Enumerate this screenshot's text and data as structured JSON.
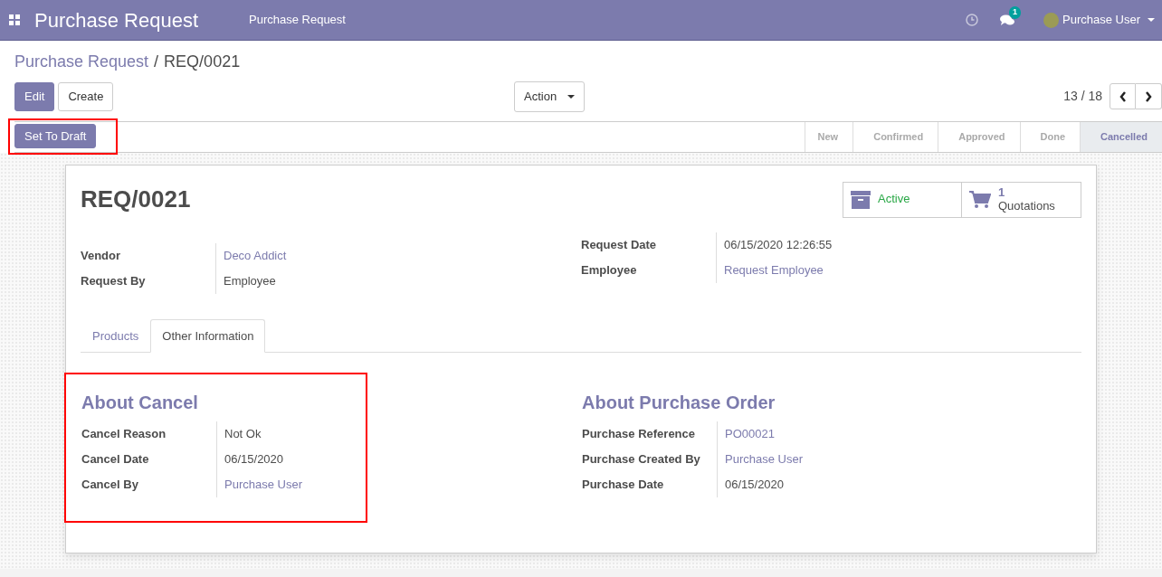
{
  "navbar": {
    "app_title": "Purchase Request",
    "menu": [
      "Purchase Request"
    ],
    "messages_count": "1",
    "user": "Purchase User"
  },
  "breadcrumb": {
    "parent": "Purchase Request",
    "separator": "/",
    "current": "REQ/0021"
  },
  "buttons": [
    "Edit",
    "Create"
  ],
  "action": "Action",
  "pager": "13 / 18",
  "status_bar": {
    "highlighted": true,
    "actions": [
      "Set To Draft"
    ],
    "stages": [
      {
        "label": "New",
        "selected": false
      },
      {
        "label": "Confirmed",
        "selected": false
      },
      {
        "label": "Approved",
        "selected": false
      },
      {
        "label": "Done",
        "selected": false
      },
      {
        "label": "Cancelled",
        "selected": true
      }
    ]
  },
  "sheet": {
    "title": "REQ/0021",
    "smart_buttons": [
      {
        "kind": "archive",
        "label": "Active"
      },
      {
        "kind": "cart",
        "count": "1",
        "label": "Quotations"
      }
    ],
    "left_fields": [
      {
        "label": "Vendor",
        "value": "Deco Addict",
        "kind": "link"
      },
      {
        "label": "Request By",
        "value": "Employee",
        "kind": "text"
      }
    ],
    "right_fields": [
      {
        "label": "Request Date",
        "value": "06/15/2020 12:26:55",
        "kind": "text"
      },
      {
        "label": "Employee",
        "value": "Request Employee",
        "kind": "link"
      }
    ],
    "tabs": [
      {
        "label": "Products",
        "selected": false
      },
      {
        "label": "Other Information",
        "selected": true
      }
    ],
    "sections": [
      {
        "title": "About Cancel",
        "highlighted": true,
        "fields": [
          {
            "label": "Cancel Reason",
            "value": "Not Ok",
            "kind": "text"
          },
          {
            "label": "Cancel Date",
            "value": "06/15/2020",
            "kind": "text"
          },
          {
            "label": "Cancel By",
            "value": "Purchase User",
            "kind": "link"
          }
        ]
      },
      {
        "title": "About Purchase Order",
        "fields": [
          {
            "label": "Purchase Reference",
            "value": "PO00021",
            "kind": "link"
          },
          {
            "label": "Purchase Created By",
            "value": "Purchase User",
            "kind": "link"
          },
          {
            "label": "Purchase Date",
            "value": "06/15/2020",
            "kind": "text"
          }
        ]
      }
    ]
  }
}
